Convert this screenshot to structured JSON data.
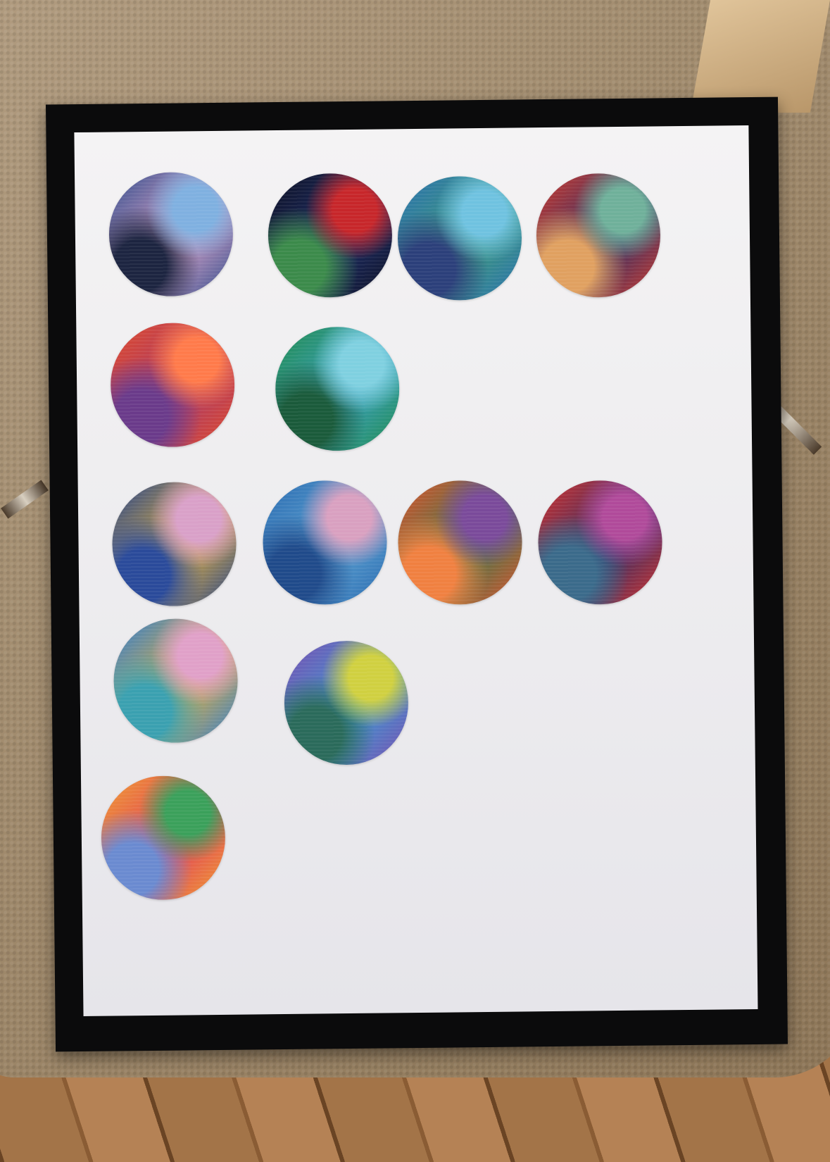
{
  "scene": {
    "description_colors": {
      "board_border": "#0b0b0c",
      "paper": "#f1f0f2",
      "rug": "#a48d6f",
      "floor": "#9a6d43"
    }
  },
  "discs": [
    {
      "name": "disc-row1-col1",
      "row": 1,
      "col": 1,
      "palette": [
        "#2d4a8a",
        "#d9a3c8",
        "#7fb0e0",
        "#1c2440"
      ]
    },
    {
      "name": "disc-row1-col2",
      "row": 1,
      "col": 2,
      "palette": [
        "#0d1020",
        "#1e2e6a",
        "#c7262a",
        "#3b8a4a"
      ]
    },
    {
      "name": "disc-row1-col3",
      "row": 1,
      "col": 3,
      "palette": [
        "#2a6fb0",
        "#3d9a7a",
        "#6fc2e0",
        "#2b3f7a"
      ]
    },
    {
      "name": "disc-row1-col4",
      "row": 1,
      "col": 4,
      "palette": [
        "#d23a2a",
        "#2a2f6a",
        "#6fb09a",
        "#e0a060"
      ]
    },
    {
      "name": "disc-row2-col1",
      "row": 2,
      "col": 1,
      "palette": [
        "#e04a2a",
        "#a83a6a",
        "#ff7a4a",
        "#6a3a8a"
      ]
    },
    {
      "name": "disc-row2-col2",
      "row": 2,
      "col": 2,
      "palette": [
        "#1f8a4a",
        "#3aa0c0",
        "#7fd0e0",
        "#1a5a3a"
      ]
    },
    {
      "name": "disc-row3-col1",
      "row": 3,
      "col": 1,
      "palette": [
        "#1f3f8a",
        "#e0b040",
        "#d9a0c8",
        "#2a4a9a"
      ]
    },
    {
      "name": "disc-row3-col2",
      "row": 3,
      "col": 2,
      "palette": [
        "#2a6ab0",
        "#5aa0d0",
        "#d9a0c0",
        "#1f4a8a"
      ]
    },
    {
      "name": "disc-row3-col3",
      "row": 3,
      "col": 3,
      "palette": [
        "#e0502a",
        "#3a7a4a",
        "#7a4a9a",
        "#f08040"
      ]
    },
    {
      "name": "disc-row3-col4",
      "row": 3,
      "col": 4,
      "palette": [
        "#d8302a",
        "#2a2f6a",
        "#b04a9a",
        "#3a6a8a"
      ]
    },
    {
      "name": "disc-row4-col1",
      "row": 4,
      "col": 1,
      "palette": [
        "#2a7ad0",
        "#e0b040",
        "#e0a0c8",
        "#3aa0b0"
      ]
    },
    {
      "name": "disc-row4-col2",
      "row": 4,
      "col": 2,
      "palette": [
        "#7a4ab0",
        "#3a9ad0",
        "#d0d040",
        "#2a6a5a"
      ]
    },
    {
      "name": "disc-row5-col1",
      "row": 5,
      "col": 1,
      "palette": [
        "#f0a030",
        "#e03a5a",
        "#3aa05a",
        "#6a8ad0"
      ]
    }
  ]
}
